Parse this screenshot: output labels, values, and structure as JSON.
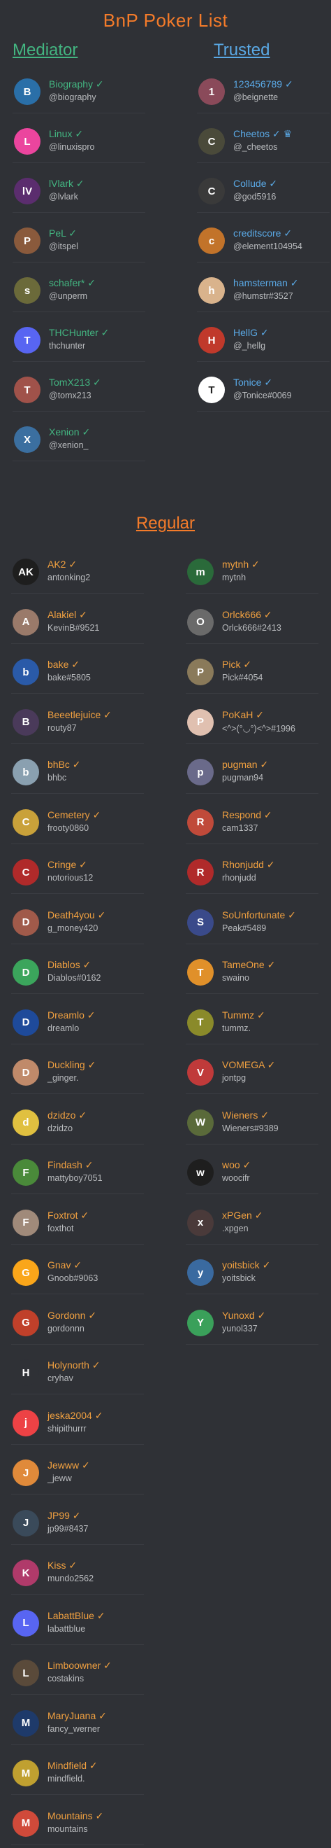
{
  "page": {
    "title": "BnP Poker List"
  },
  "mediator": {
    "heading": "Mediator",
    "color": "#43b581",
    "entries": [
      {
        "name": "Biography ✓",
        "handle": "@biography",
        "avatar_color": "#2a6fa8",
        "initial": "B"
      },
      {
        "name": "Linux ✓",
        "handle": "@linuxispro",
        "avatar_color": "#eb459e",
        "initial": "L"
      },
      {
        "name": "lVlark ✓",
        "handle": "@lvlark",
        "avatar_color": "#5b2d6e",
        "initial": "lV"
      },
      {
        "name": "PeL ✓",
        "handle": "@itspel",
        "avatar_color": "#8a5a3c",
        "initial": "P"
      },
      {
        "name": "schafer* ✓",
        "handle": "@unperm",
        "avatar_color": "#6b6a3a",
        "initial": "s"
      },
      {
        "name": "THCHunter ✓",
        "handle": "thchunter",
        "avatar_color": "#5865f2",
        "initial": "T"
      },
      {
        "name": "TomX213 ✓",
        "handle": "@tomx213",
        "avatar_color": "#a0524a",
        "initial": "T"
      },
      {
        "name": "Xenion ✓",
        "handle": "@xenion_",
        "avatar_color": "#3b6fa0",
        "initial": "X"
      }
    ]
  },
  "trusted": {
    "heading": "Trusted",
    "color": "#5aa9e6",
    "entries": [
      {
        "name": "123456789 ✓",
        "handle": "@beignette",
        "avatar_color": "#8a4a5a",
        "initial": "1"
      },
      {
        "name": "Cheetos ✓ ♛",
        "handle": "@_cheetos",
        "avatar_color": "#4a4a3a",
        "initial": "C"
      },
      {
        "name": "Collude ✓",
        "handle": "@god5916",
        "avatar_color": "#3a3a3a",
        "initial": "C"
      },
      {
        "name": "creditscore ✓",
        "handle": "@element104954",
        "avatar_color": "#c2732a",
        "initial": "c"
      },
      {
        "name": "hamsterman ✓",
        "handle": "@humstr#3527",
        "avatar_color": "#d9b38c",
        "initial": "h"
      },
      {
        "name": "HellG ✓",
        "handle": "@_hellg",
        "avatar_color": "#c0392b",
        "initial": "H"
      },
      {
        "name": "Tonice ✓",
        "handle": "@Tonice#0069",
        "avatar_color": "#ffffff",
        "initial": "T"
      }
    ]
  },
  "regular": {
    "heading": "Regular",
    "color": "#f47b2a",
    "left": [
      {
        "name": "AK2 ✓",
        "handle": "antonking2",
        "avatar_color": "#1e1e1e",
        "initial": "AK"
      },
      {
        "name": "Alakiel ✓",
        "handle": "KevinB#9521",
        "avatar_color": "#9a7a6a",
        "initial": "A"
      },
      {
        "name": "bake ✓",
        "handle": "bake#5805",
        "avatar_color": "#2a5aa8",
        "initial": "b"
      },
      {
        "name": "Beeetlejuice ✓",
        "handle": "routy87",
        "avatar_color": "#4a3a5a",
        "initial": "B"
      },
      {
        "name": "bhBc ✓",
        "handle": "bhbc",
        "avatar_color": "#8aa0b0",
        "initial": "b"
      },
      {
        "name": "Cemetery ✓",
        "handle": "frooty0860",
        "avatar_color": "#c9a13a",
        "initial": "C"
      },
      {
        "name": "Cringe ✓",
        "handle": "notorious12",
        "avatar_color": "#b02a2a",
        "initial": "C"
      },
      {
        "name": "Death4you ✓",
        "handle": "g_money420",
        "avatar_color": "#a05a4a",
        "initial": "D"
      },
      {
        "name": "Diablos ✓",
        "handle": "Diablos#0162",
        "avatar_color": "#3ba55c",
        "initial": "D"
      },
      {
        "name": "Dreamlo ✓",
        "handle": "dreamlo",
        "avatar_color": "#1e4a9a",
        "initial": "D"
      },
      {
        "name": "Duckling ✓",
        "handle": "_ginger.",
        "avatar_color": "#c08a6a",
        "initial": "D"
      },
      {
        "name": "dzidzo ✓",
        "handle": "dzidzo",
        "avatar_color": "#e0c040",
        "initial": "d"
      },
      {
        "name": "Findash ✓",
        "handle": "mattyboy7051",
        "avatar_color": "#4a8a3a",
        "initial": "F"
      },
      {
        "name": "Foxtrot ✓",
        "handle": "foxthot",
        "avatar_color": "#a08a7a",
        "initial": "F"
      },
      {
        "name": "Gnav ✓",
        "handle": "Gnoob#9063",
        "avatar_color": "#faa61a",
        "initial": "G"
      },
      {
        "name": "Gordonn ✓",
        "handle": "gordonnn",
        "avatar_color": "#c0402a",
        "initial": "G"
      },
      {
        "name": "Holynorth ✓",
        "handle": "cryhav",
        "avatar_color": "#2f3136",
        "initial": "H"
      },
      {
        "name": "jeska2004 ✓",
        "handle": "shipithurrr",
        "avatar_color": "#ed4245",
        "initial": "j"
      },
      {
        "name": "Jewww ✓",
        "handle": "_jeww",
        "avatar_color": "#e08a3a",
        "initial": "J"
      },
      {
        "name": "JP99 ✓",
        "handle": "jp99#8437",
        "avatar_color": "#3a4a5a",
        "initial": "J"
      },
      {
        "name": "Kiss ✓",
        "handle": "mundo2562",
        "avatar_color": "#b03a6a",
        "initial": "K"
      },
      {
        "name": "LabattBlue ✓",
        "handle": "labattblue",
        "avatar_color": "#5865f2",
        "initial": "L"
      },
      {
        "name": "Limboowner ✓",
        "handle": "costakins",
        "avatar_color": "#5a4a3a",
        "initial": "L"
      },
      {
        "name": "MaryJuana ✓",
        "handle": "fancy_werner",
        "avatar_color": "#1e3a6a",
        "initial": "M"
      },
      {
        "name": "Mindfield ✓",
        "handle": "mindfield.",
        "avatar_color": "#c0a030",
        "initial": "M"
      },
      {
        "name": "Mountains ✓",
        "handle": "mountains",
        "avatar_color": "#d04a3a",
        "initial": "M"
      }
    ],
    "right": [
      {
        "name": "mytnh ✓",
        "handle": "mytnh",
        "avatar_color": "#2a6a3a",
        "initial": "m"
      },
      {
        "name": "Orlck666 ✓",
        "handle": "Orlck666#2413",
        "avatar_color": "#6a6a6a",
        "initial": "O"
      },
      {
        "name": "Pick ✓",
        "handle": "Pick#4054",
        "avatar_color": "#8a7a5a",
        "initial": "P"
      },
      {
        "name": "PoKaH ✓",
        "handle": "<^>(°◡°)<^>#1996",
        "avatar_color": "#e0c0b0",
        "initial": "P"
      },
      {
        "name": "pugman ✓",
        "handle": "pugman94",
        "avatar_color": "#6a6a8a",
        "initial": "p"
      },
      {
        "name": "Respond ✓",
        "handle": "cam1337",
        "avatar_color": "#c04a3a",
        "initial": "R"
      },
      {
        "name": "Rhonjudd ✓",
        "handle": "rhonjudd",
        "avatar_color": "#b02a2a",
        "initial": "R"
      },
      {
        "name": "SoUnfortunate ✓",
        "handle": "Peak#5489",
        "avatar_color": "#3a4a8a",
        "initial": "S"
      },
      {
        "name": "TameOne ✓",
        "handle": "swaino",
        "avatar_color": "#e0902a",
        "initial": "T"
      },
      {
        "name": "Tummz ✓",
        "handle": "tummz.",
        "avatar_color": "#8a8a2a",
        "initial": "T"
      },
      {
        "name": "VOMEGA ✓",
        "handle": "jontpg",
        "avatar_color": "#c03a3a",
        "initial": "V"
      },
      {
        "name": "Wieners ✓",
        "handle": "Wieners#9389",
        "avatar_color": "#5a6a3a",
        "initial": "W"
      },
      {
        "name": "woo ✓",
        "handle": "woocifr",
        "avatar_color": "#1e1e1e",
        "initial": "w"
      },
      {
        "name": "xPGen ✓",
        "handle": ".xpgen",
        "avatar_color": "#4a3a3a",
        "initial": "x"
      },
      {
        "name": "yoitsbick ✓",
        "handle": "yoitsbick",
        "avatar_color": "#3a6aa0",
        "initial": "y"
      },
      {
        "name": "Yunoxd ✓",
        "handle": "yunol337",
        "avatar_color": "#3aa05a",
        "initial": "Y"
      }
    ]
  }
}
